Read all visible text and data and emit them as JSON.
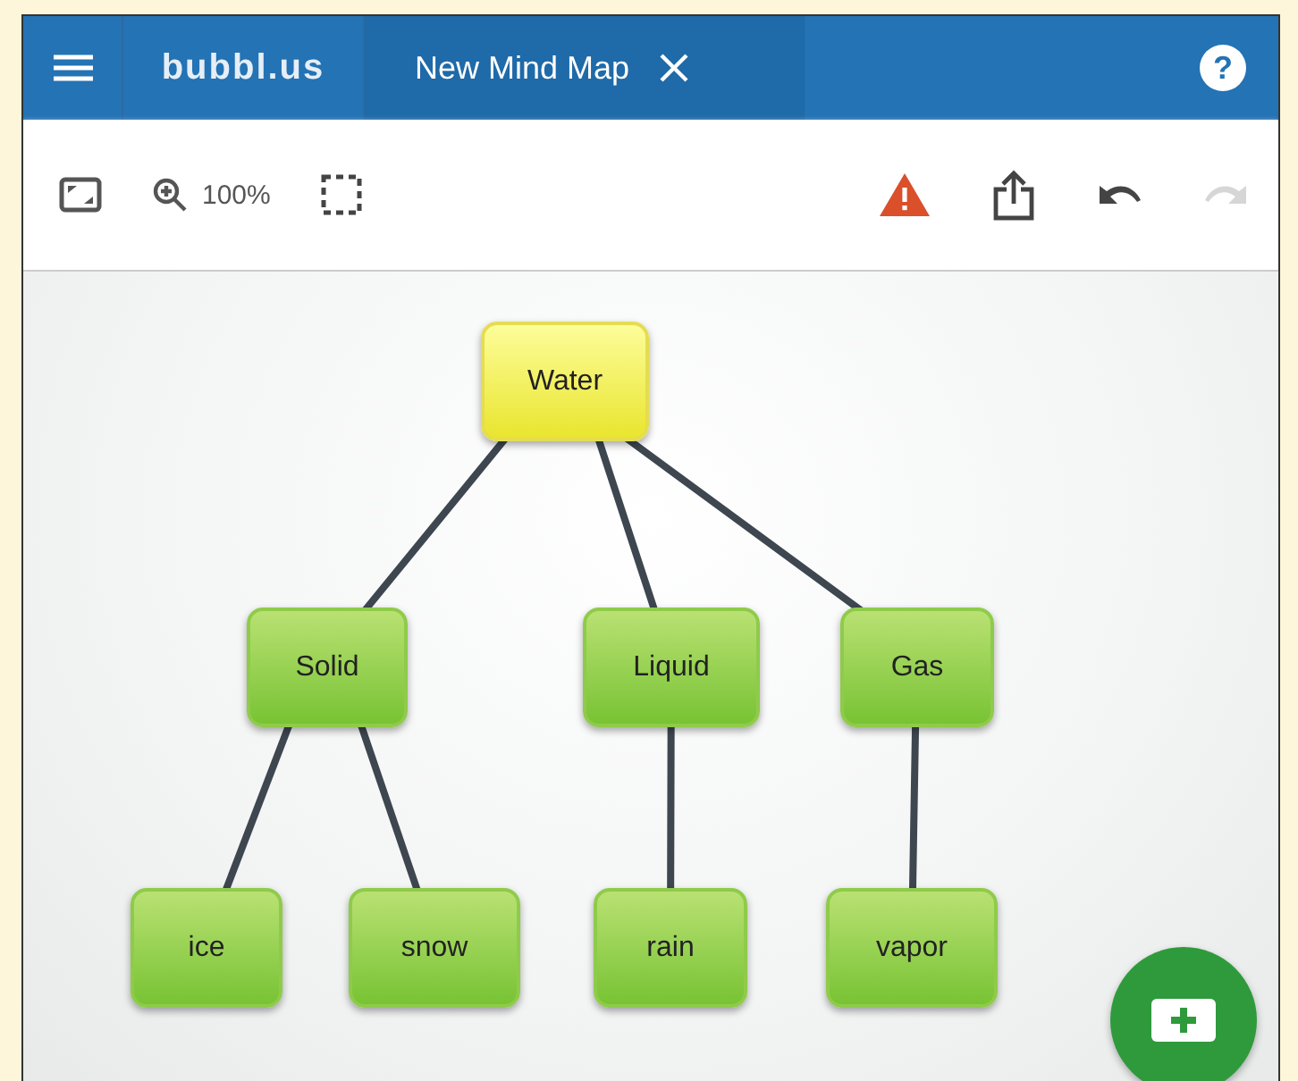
{
  "header": {
    "logo": "bubbl.us",
    "tab": {
      "label": "New Mind Map",
      "selected": true
    },
    "help": "?"
  },
  "toolbar": [
    {
      "kind": "fit",
      "disabled": false
    },
    {
      "kind": "zoom",
      "label": "100%",
      "disabled": false
    },
    {
      "kind": "select",
      "disabled": false
    },
    {
      "kind": "warning",
      "disabled": false
    },
    {
      "kind": "share",
      "disabled": false
    },
    {
      "kind": "undo",
      "disabled": false
    },
    {
      "kind": "redo",
      "disabled": true
    }
  ],
  "mind_map": {
    "root": {
      "text": "Water",
      "selected": true,
      "children": [
        {
          "text": "Solid",
          "selected": false,
          "children": [
            {
              "text": "ice",
              "selected": false
            },
            {
              "text": "snow",
              "selected": false
            }
          ]
        },
        {
          "text": "Liquid",
          "selected": false,
          "children": [
            {
              "text": "rain",
              "selected": false
            }
          ]
        },
        {
          "text": "Gas",
          "selected": false,
          "children": [
            {
              "text": "vapor",
              "selected": false
            }
          ]
        }
      ]
    }
  }
}
